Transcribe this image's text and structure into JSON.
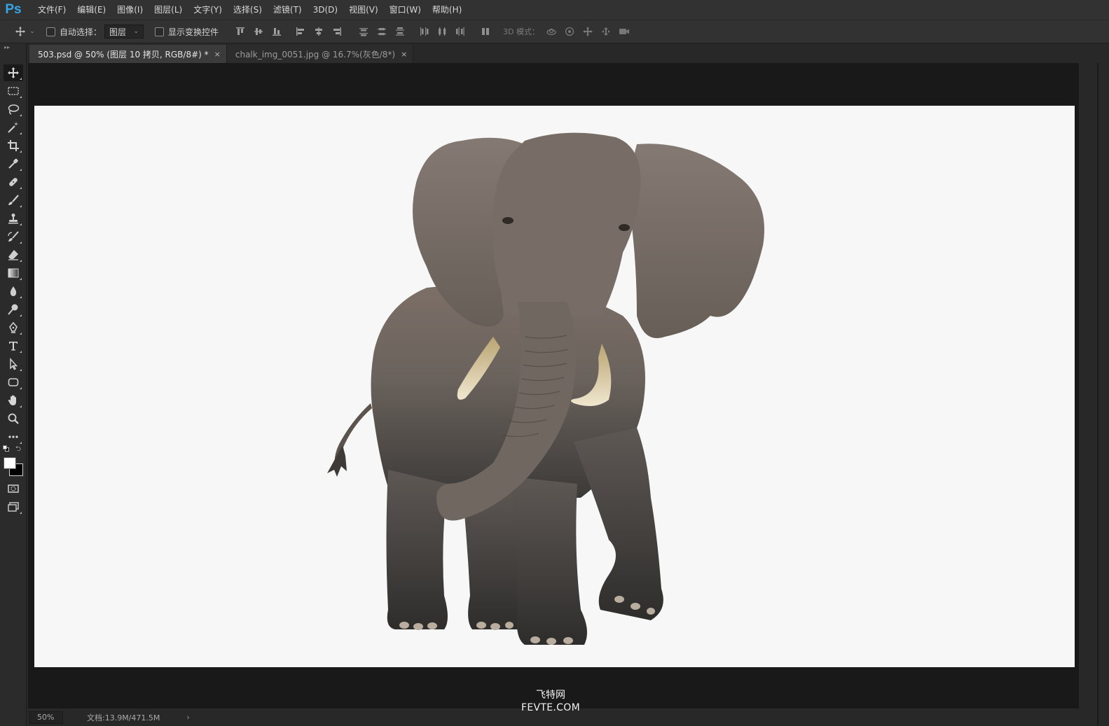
{
  "app": {
    "logo": "Ps",
    "menus": [
      "文件(F)",
      "编辑(E)",
      "图像(I)",
      "图层(L)",
      "文字(Y)",
      "选择(S)",
      "滤镜(T)",
      "3D(D)",
      "视图(V)",
      "窗口(W)",
      "帮助(H)"
    ]
  },
  "options": {
    "tool_icon": "move-icon",
    "auto_select_label": "自动选择：",
    "auto_select_checked": false,
    "auto_select_target": "图层",
    "show_transform_label": "显示变换控件",
    "show_transform_checked": false,
    "mode3d_label": "3D 模式："
  },
  "tabs": [
    {
      "label": "503.psd @ 50% (图层 10 拷贝, RGB/8#) *",
      "active": true,
      "close": "×"
    },
    {
      "label": "chalk_img_0051.jpg @ 16.7%(灰色/8*)",
      "active": false,
      "close": "×"
    }
  ],
  "tools": [
    "move-icon",
    "marquee-icon",
    "lasso-icon",
    "magic-wand-icon",
    "crop-icon",
    "eyedropper-icon",
    "healing-brush-icon",
    "brush-icon",
    "clone-stamp-icon",
    "history-brush-icon",
    "eraser-icon",
    "gradient-icon",
    "blur-icon",
    "dodge-icon",
    "pen-icon",
    "type-icon",
    "path-selection-icon",
    "rectangle-shape-icon",
    "hand-icon",
    "zoom-icon",
    "more-icon"
  ],
  "colors": {
    "foreground": "#ffffff",
    "background": "#000000",
    "canvas": "#f7f7f7",
    "ps_blue": "#35a7e7"
  },
  "status": {
    "zoom": "50%",
    "doc_info": "文档:13.9M/471.5M",
    "arrow": "›"
  },
  "watermark": {
    "cn": "飞特网",
    "en": "FEVTE.COM"
  }
}
